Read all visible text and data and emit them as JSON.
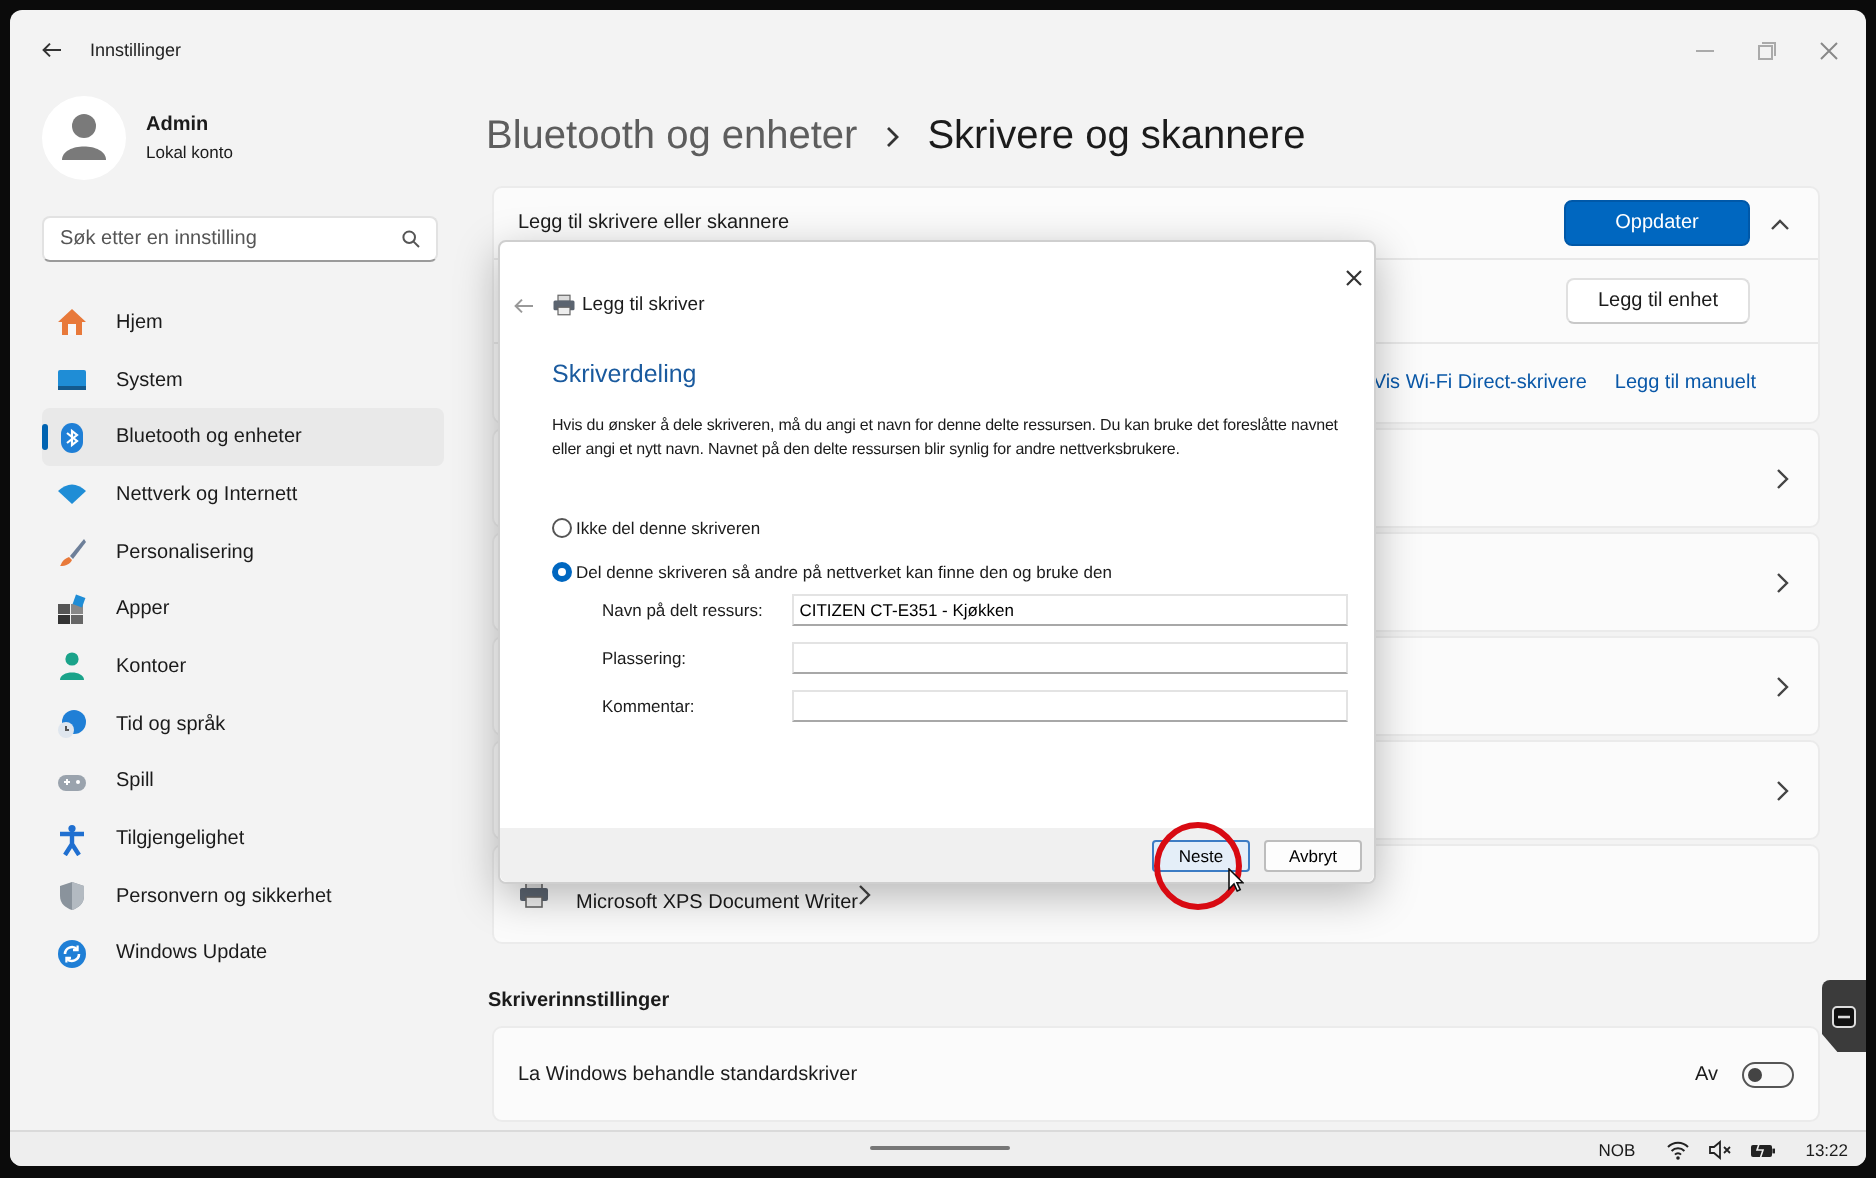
{
  "window": {
    "title": "Innstillinger"
  },
  "account": {
    "name": "Admin",
    "type": "Lokal konto"
  },
  "search": {
    "placeholder": "Søk etter en innstilling"
  },
  "nav": [
    {
      "label": "Hjem",
      "kind": "home",
      "selected": false
    },
    {
      "label": "System",
      "kind": "system",
      "selected": false
    },
    {
      "label": "Bluetooth og enheter",
      "kind": "bluetooth",
      "selected": true
    },
    {
      "label": "Nettverk og Internett",
      "kind": "network",
      "selected": false
    },
    {
      "label": "Personalisering",
      "kind": "brush",
      "selected": false
    },
    {
      "label": "Apper",
      "kind": "apps",
      "selected": false
    },
    {
      "label": "Kontoer",
      "kind": "accounts",
      "selected": false
    },
    {
      "label": "Tid og språk",
      "kind": "time",
      "selected": false
    },
    {
      "label": "Spill",
      "kind": "gaming",
      "selected": false
    },
    {
      "label": "Tilgjengelighet",
      "kind": "accessibility",
      "selected": false
    },
    {
      "label": "Personvern og sikkerhet",
      "kind": "privacy",
      "selected": false
    },
    {
      "label": "Windows Update",
      "kind": "update",
      "selected": false
    }
  ],
  "breadcrumb": {
    "parent": "Bluetooth og enheter",
    "current": "Skrivere og skannere"
  },
  "add_section": {
    "label": "Legg til skrivere eller skannere",
    "refresh_button": "Oppdater",
    "expanded": true,
    "add_device_button": "Legg til enhet",
    "links": [
      "Vis Wi-Fi Direct-skrivere",
      "Legg til manuelt"
    ]
  },
  "printers": [
    {
      "kind": "covered"
    },
    {
      "kind": "covered"
    },
    {
      "kind": "covered"
    },
    {
      "kind": "covered"
    },
    {
      "kind": "printer",
      "name": "Microsoft XPS Document Writer"
    }
  ],
  "printer_settings": {
    "heading": "Skriverinnstillinger",
    "rows": [
      {
        "label": "La Windows behandle standardskriver",
        "state_text": "Av",
        "on": false
      }
    ]
  },
  "dialog": {
    "heading": "Legg til skriver",
    "title": "Skriverdeling",
    "description": "Hvis du ønsker å dele skriveren, må du angi et navn for denne delte ressursen. Du kan bruke det foreslåtte navnet eller angi et nytt navn. Navnet på den delte ressursen blir synlig for andre nettverksbrukere.",
    "options": [
      {
        "label": "Ikke del denne skriveren",
        "selected": false
      },
      {
        "label": "Del denne skriveren så andre på nettverket kan finne den og bruke den",
        "selected": true
      }
    ],
    "fields": [
      {
        "label": "Navn på delt ressurs:",
        "value": "CITIZEN CT-E351 - Kjøkken"
      },
      {
        "label": "Plassering:"
      },
      {
        "label": "Kommentar:"
      }
    ],
    "buttons": [
      {
        "label": "Neste",
        "default": true
      },
      {
        "label": "Avbryt",
        "default": false
      }
    ]
  },
  "taskbar": {
    "language": "NOB",
    "time": "13:22"
  }
}
